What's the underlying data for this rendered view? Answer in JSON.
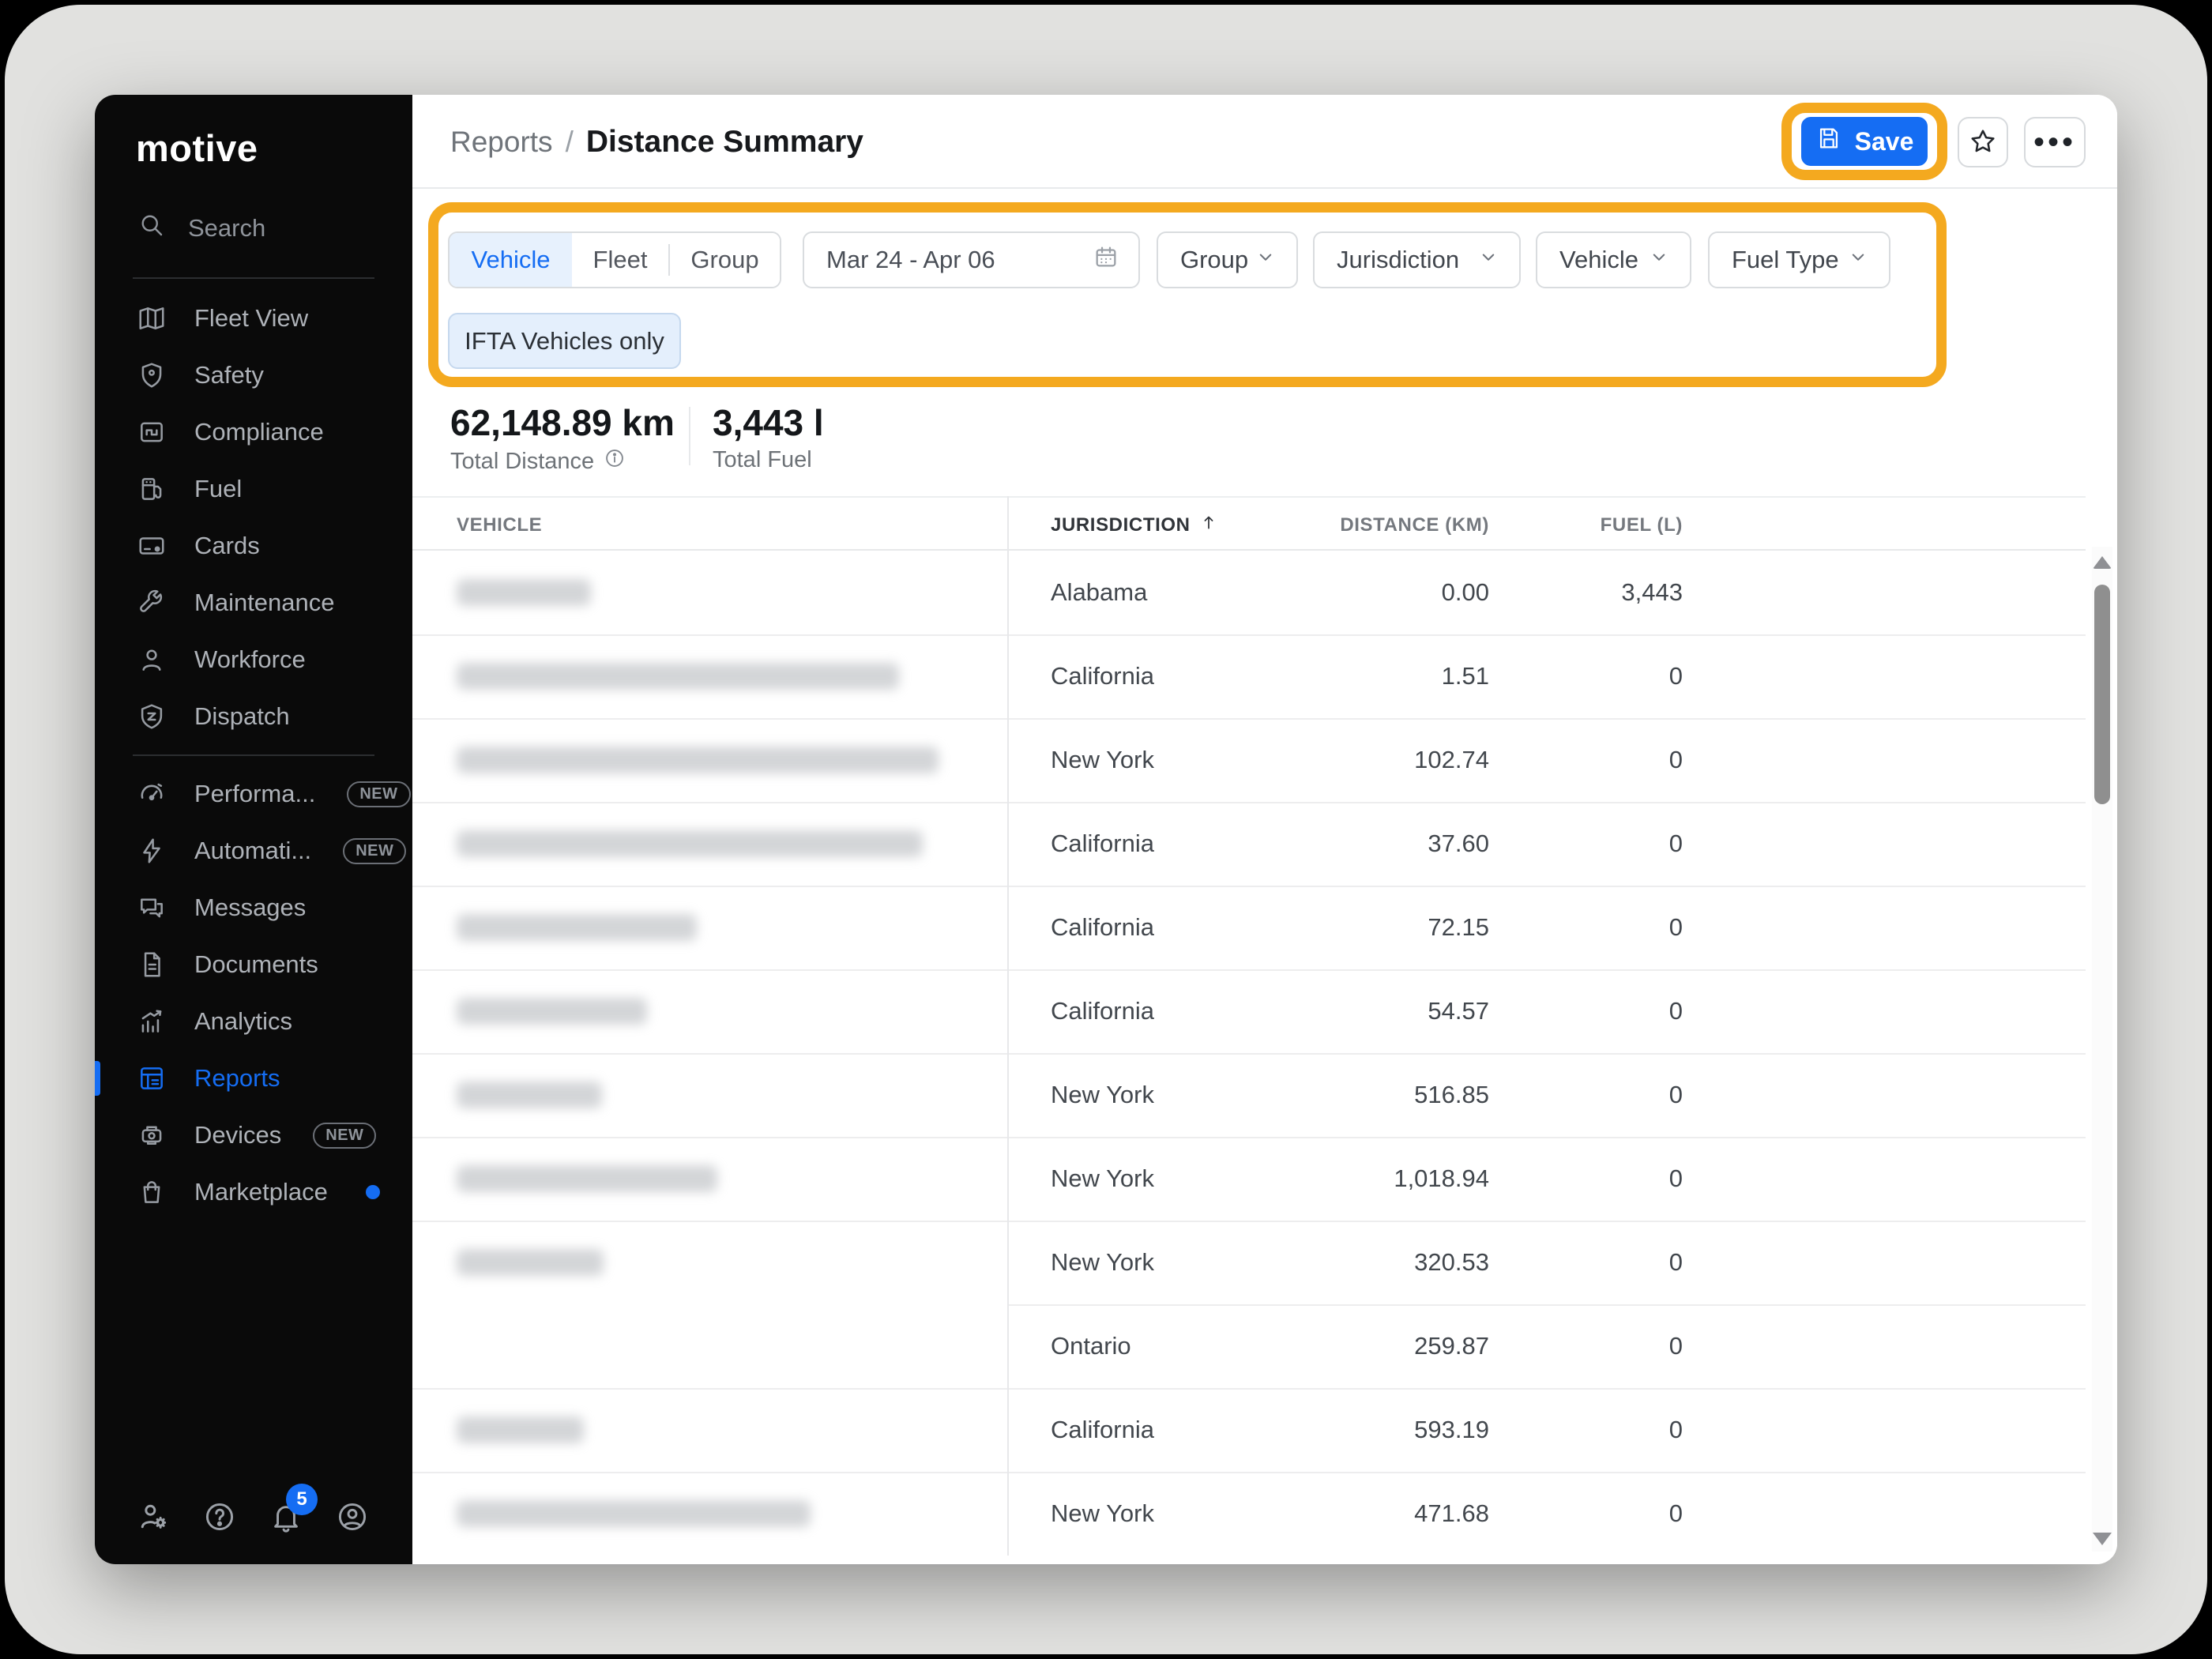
{
  "sidebar": {
    "logo": "motive",
    "search_label": "Search",
    "nav_primary": [
      {
        "icon": "map",
        "label": "Fleet View"
      },
      {
        "icon": "shield",
        "label": "Safety"
      },
      {
        "icon": "compliance",
        "label": "Compliance"
      },
      {
        "icon": "fuel",
        "label": "Fuel"
      },
      {
        "icon": "card",
        "label": "Cards"
      },
      {
        "icon": "wrench",
        "label": "Maintenance"
      },
      {
        "icon": "person",
        "label": "Workforce"
      },
      {
        "icon": "dispatch",
        "label": "Dispatch"
      }
    ],
    "nav_secondary": [
      {
        "icon": "gauge",
        "label": "Performa...",
        "badge": "NEW"
      },
      {
        "icon": "bolt",
        "label": "Automati...",
        "badge": "NEW"
      },
      {
        "icon": "messages",
        "label": "Messages"
      },
      {
        "icon": "document",
        "label": "Documents"
      },
      {
        "icon": "analytics",
        "label": "Analytics"
      },
      {
        "icon": "reports",
        "label": "Reports",
        "active": true
      },
      {
        "icon": "devices",
        "label": "Devices",
        "badge": "NEW"
      },
      {
        "icon": "marketplace",
        "label": "Marketplace",
        "dot": true
      }
    ],
    "footer_icons": [
      {
        "icon": "person-gear"
      },
      {
        "icon": "help"
      },
      {
        "icon": "bell",
        "badge": "5"
      },
      {
        "icon": "avatar"
      }
    ],
    "notification_count": "5"
  },
  "header": {
    "breadcrumb_parent": "Reports",
    "breadcrumb_separator": "/",
    "title": "Distance Summary",
    "save_label": "Save"
  },
  "filters": {
    "segments": [
      {
        "label": "Vehicle",
        "active": true
      },
      {
        "label": "Fleet",
        "active": false
      },
      {
        "label": "Group",
        "active": false
      }
    ],
    "date_range": "Mar 24 - Apr 06",
    "dropdowns": [
      "Group",
      "Jurisdiction",
      "Vehicle",
      "Fuel Type"
    ],
    "chip": "IFTA Vehicles only"
  },
  "summary": {
    "total_distance": "62,148.89 km",
    "total_distance_label": "Total Distance",
    "total_fuel": "3,443 l",
    "total_fuel_label": "Total Fuel"
  },
  "table": {
    "columns": [
      "VEHICLE",
      "JURISDICTION",
      "DISTANCE (KM)",
      "FUEL (L)"
    ],
    "sorted_column": "JURISDICTION",
    "sort_direction": "asc",
    "rows": [
      {
        "vehicle_blur_width": 170,
        "jurisdiction": "Alabama",
        "distance": "0.00",
        "fuel": "3,443"
      },
      {
        "vehicle_blur_width": 560,
        "jurisdiction": "California",
        "distance": "1.51",
        "fuel": "0"
      },
      {
        "vehicle_blur_width": 610,
        "jurisdiction": "New York",
        "distance": "102.74",
        "fuel": "0"
      },
      {
        "vehicle_blur_width": 590,
        "jurisdiction": "California",
        "distance": "37.60",
        "fuel": "0"
      },
      {
        "vehicle_blur_width": 304,
        "jurisdiction": "California",
        "distance": "72.15",
        "fuel": "0"
      },
      {
        "vehicle_blur_width": 241,
        "jurisdiction": "California",
        "distance": "54.57",
        "fuel": "0"
      },
      {
        "vehicle_blur_width": 184,
        "jurisdiction": "New York",
        "distance": "516.85",
        "fuel": "0"
      },
      {
        "vehicle_blur_width": 330,
        "jurisdiction": "New York",
        "distance": "1,018.94",
        "fuel": "0"
      },
      {
        "vehicle_blur_width": 186,
        "jurisdiction": "New York",
        "distance": "320.53",
        "fuel": "0"
      },
      {
        "vehicle_blur_width": 0,
        "jurisdiction": "Ontario",
        "distance": "259.87",
        "fuel": "0",
        "merged_with_above": true
      },
      {
        "vehicle_blur_width": 161,
        "jurisdiction": "California",
        "distance": "593.19",
        "fuel": "0"
      },
      {
        "vehicle_blur_width": 448,
        "jurisdiction": "New York",
        "distance": "471.68",
        "fuel": "0"
      }
    ]
  },
  "colors": {
    "accent": "#156df3",
    "annotation": "#f4a91f",
    "sidebar_bg": "#0a0a0a",
    "active_segment_bg": "#e7f1fd",
    "chip_bg": "#e4effc",
    "desktop_bg": "#e1e1df"
  }
}
